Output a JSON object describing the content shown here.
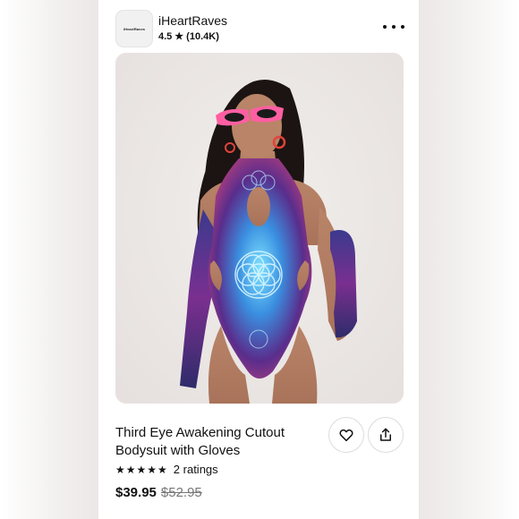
{
  "store": {
    "logo_text": "iHeartRaves",
    "name": "iHeartRaves",
    "rating": "4.5",
    "star_icon": "★",
    "review_count": "(10.4K)"
  },
  "header": {
    "more_icon": "more-horizontal-icon"
  },
  "product": {
    "title": "Third Eye Awakening Cutout Bodysuit with Gloves",
    "stars": "★★★★★",
    "ratings_label": "2 ratings",
    "price": "$39.95",
    "original_price": "$52.95",
    "photo_alt": "Model wearing psychedelic flower-of-life cutout bodysuit with arm gloves and pink sunglasses"
  },
  "actions": {
    "favorite_icon": "heart-icon",
    "share_icon": "share-icon"
  },
  "colors": {
    "accent_pink": "#ff5fa2",
    "print_blue": "#3fa8e8",
    "print_purple": "#5a2d8c",
    "background": "#efefef"
  }
}
